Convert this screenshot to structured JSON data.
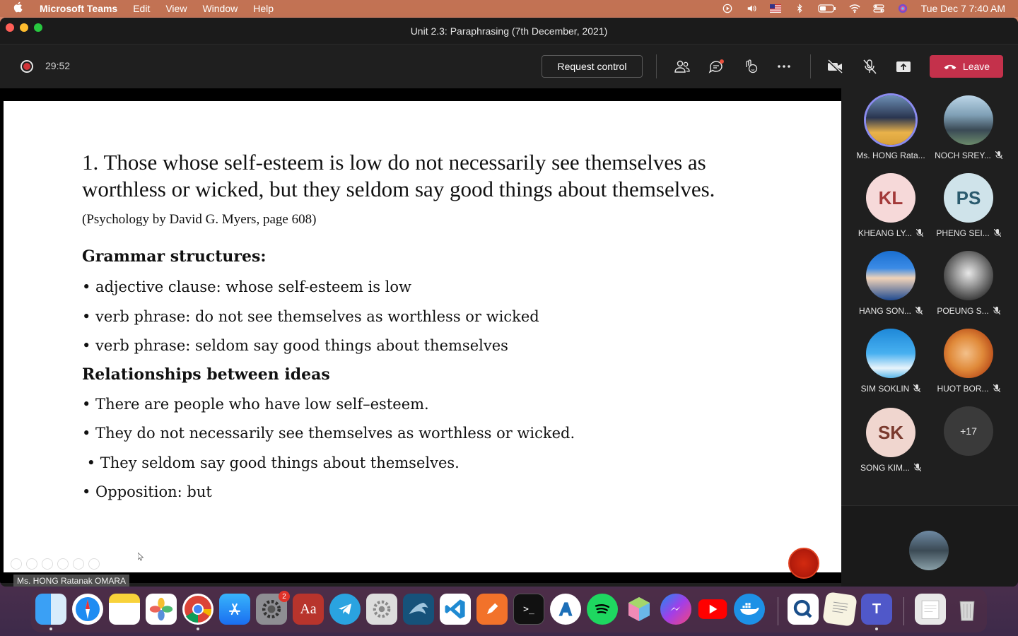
{
  "menubar": {
    "app": "Microsoft Teams",
    "items": [
      "Edit",
      "View",
      "Window",
      "Help"
    ],
    "datetime": "Tue Dec 7  7:40 AM"
  },
  "window": {
    "title": "Unit 2.3: Paraphrasing (7th December, 2021)"
  },
  "toolbar": {
    "timer": "29:52",
    "request_control": "Request control",
    "leave": "Leave"
  },
  "slide": {
    "quote_main": "1. Those whose self-esteem is low do not necessarily see themselves as worthless or wicked, but they seldom say good things about themselves.",
    "quote_source": "(Psychology by David G. Myers, page 608)",
    "lines": [
      "Grammar structures:",
      "• adjective clause: whose self-esteem is low",
      "• verb phrase: do not see themselves as worthless or wicked",
      "• verb phrase: seldom say good things about themselves",
      "Relationships between ideas",
      "• There are people who have low self–esteem.",
      "• They do not necessarily see themselves as worthless or wicked.",
      " • They seldom say good things about themselves.",
      "• Opposition: but"
    ],
    "presenter": "Ms. HONG Ratanak OMARA"
  },
  "participants": [
    {
      "name": "Ms. HONG Rata...",
      "initials": "",
      "muted": false
    },
    {
      "name": "NOCH SREY...",
      "initials": "",
      "muted": true
    },
    {
      "name": "KHEANG LY...",
      "initials": "KL",
      "muted": true
    },
    {
      "name": "PHENG SEI...",
      "initials": "PS",
      "muted": true
    },
    {
      "name": "HANG SON...",
      "initials": "",
      "muted": true
    },
    {
      "name": "POEUNG S...",
      "initials": "",
      "muted": true
    },
    {
      "name": "SIM SOKLIN",
      "initials": "",
      "muted": true
    },
    {
      "name": "HUOT BOR...",
      "initials": "",
      "muted": true
    },
    {
      "name": "SONG KIM...",
      "initials": "SK",
      "muted": true
    }
  ],
  "more_participants": "+17",
  "dock": {
    "settings_badge": "2"
  },
  "colors": {
    "leave": "#c4314b",
    "teams_bg": "#1f1f1f",
    "speaker_ring": "#8b8cf0"
  }
}
